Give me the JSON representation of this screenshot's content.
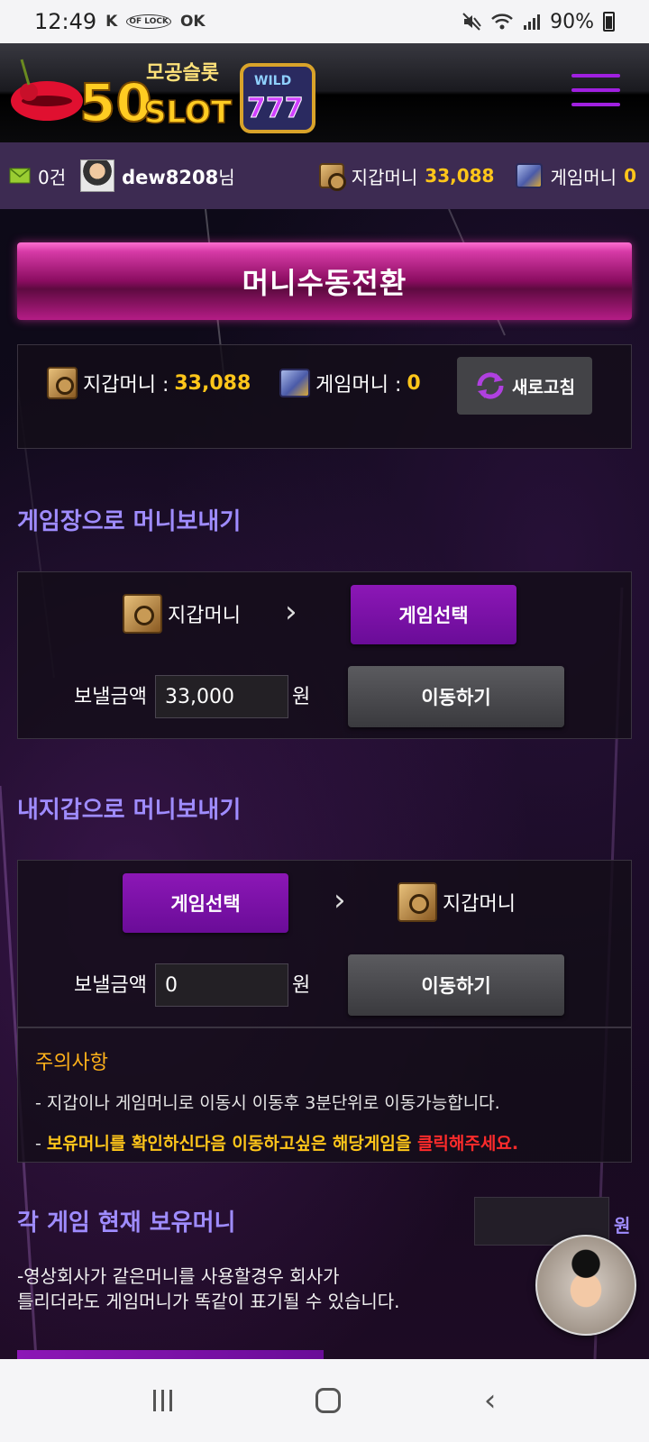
{
  "status_bar": {
    "time": "12:49",
    "left_icons": [
      "K",
      "OF LOCK",
      "OK"
    ],
    "battery": "90%"
  },
  "header": {
    "logo_text": "50SLOT",
    "logo_subtext": "모공슬롯",
    "logo_badge": "WILD 777",
    "menu_icon": "hamburger-icon",
    "accent_color": "#a020e0"
  },
  "user_bar": {
    "messages": "0건",
    "username": "dew8208",
    "honorific": "님",
    "wallet_label": "지갑머니",
    "wallet_value": "33,088",
    "game_label": "게임머니",
    "game_value": "0"
  },
  "page_title": "머니수동전환",
  "balance": {
    "wallet_label": "지갑머니 : ",
    "wallet_value": "33,088",
    "game_label": "게임머니 : ",
    "game_value": "0",
    "refresh_label": "새로고침"
  },
  "to_game": {
    "title": "게임장으로 머니보내기",
    "from_label": "지갑머니",
    "select_label": "게임선택",
    "amount_label": "보낼금액",
    "amount_value": "33,000",
    "currency": "원",
    "move_label": "이동하기"
  },
  "to_wallet": {
    "title": "내지갑으로 머니보내기",
    "select_label": "게임선택",
    "to_label": "지갑머니",
    "amount_label": "보낼금액",
    "amount_value": "0",
    "currency": "원",
    "move_label": "이동하기"
  },
  "notice": {
    "title": "주의사항",
    "line1": "- 지갑이나 게임머니로 이동시 이동후 3분단위로 이동가능합니다.",
    "line2_prefix": "- ",
    "line2_yellow": "보유머니를 확인하신다음 이동하고싶은 해당게임을 ",
    "line2_red": "클릭해주세요."
  },
  "holdings": {
    "title": "각 게임 현재 보유머니",
    "currency": "원",
    "desc_line1": "-영상회사가 같은머니를 사용할경우 회사가",
    "desc_line2": "틀리더라도 게임머니가 똑같이 표기될 수 있습니다."
  },
  "colors": {
    "section_title": "#9f8cff",
    "highlight_yellow": "#ffc61a",
    "notice_red": "#ff2b2b",
    "purple_button": "#8c17b6"
  }
}
